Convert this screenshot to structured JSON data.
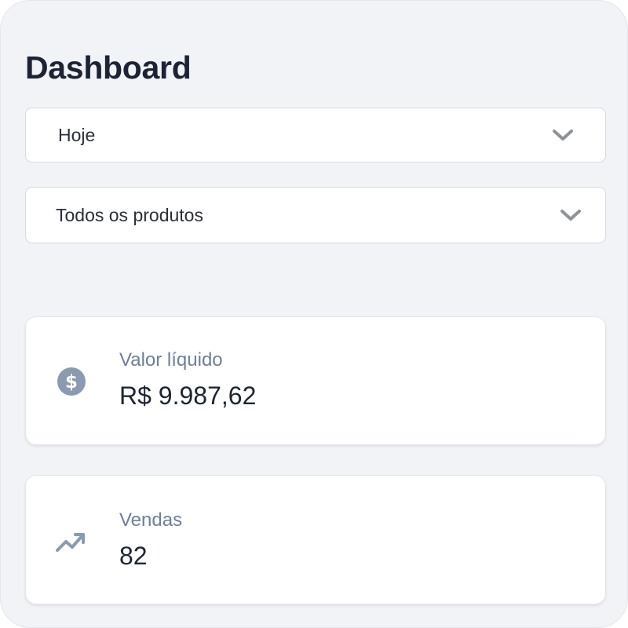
{
  "page": {
    "title": "Dashboard"
  },
  "filters": {
    "period": {
      "selected": "Hoje",
      "icon": "chevron-down-icon"
    },
    "product": {
      "selected": "Todos os produtos",
      "icon": "chevron-down-icon"
    }
  },
  "metrics": [
    {
      "label": "Valor líquido",
      "value": "R$ 9.987,62",
      "icon": "dollar-coin-icon"
    },
    {
      "label": "Vendas",
      "value": "82",
      "icon": "trending-up-icon"
    }
  ],
  "colors": {
    "background": "#f1f3f6",
    "card": "#ffffff",
    "title": "#1b2335",
    "label": "#6d7f99",
    "icon": "#8a9ab0",
    "chevron": "#8f9297"
  }
}
